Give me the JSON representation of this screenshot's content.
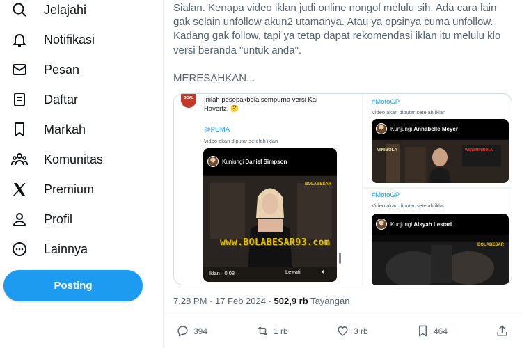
{
  "sidebar": {
    "items": [
      {
        "label": "Jelajahi",
        "icon": "search-icon"
      },
      {
        "label": "Notifikasi",
        "icon": "bell-icon"
      },
      {
        "label": "Pesan",
        "icon": "mail-icon"
      },
      {
        "label": "Daftar",
        "icon": "list-icon"
      },
      {
        "label": "Markah",
        "icon": "bookmark-icon"
      },
      {
        "label": "Komunitas",
        "icon": "people-icon"
      },
      {
        "label": "Premium",
        "icon": "x-logo-icon"
      },
      {
        "label": "Profil",
        "icon": "person-icon"
      },
      {
        "label": "Lainnya",
        "icon": "more-circle-icon"
      }
    ],
    "post_button": "Posting"
  },
  "tweet": {
    "text_line1": "Sialan. Kenapa video iklan judi online nongol melulu sih. Ada cara lain gak selain unfollow akun2 utamanya. Atau ya opsinya cuma unfollow. Kadang gak follow, tapi ya tetap dapat rekomendasi iklan itu melulu klo versi beranda \"untuk anda\".",
    "text_line2": "MERESAHKAN...",
    "time": "7.28 PM · 17 Feb 2024 · ",
    "views_count": "502,9 rb",
    "views_label": " Tayangan"
  },
  "media": {
    "left": {
      "avatar_text": "GOAL",
      "text": "Inilah pesepakbola sempurna versi Kai Havertz. 🤔",
      "mention": "@PUMA",
      "ad_note": "Video akan diputar setelah iklan",
      "visit_prefix": "Kunjungi ",
      "visit_name": "Daniel Simpson",
      "watermark": "www.BOLABESAR93.com",
      "logo": "BOLABESAR",
      "ad_time": "Iklan · 0:08",
      "skip": "Lewati"
    },
    "right_top": {
      "hashtag": "#MotoGP",
      "ad_note": "Video akan diputar setelah iklan",
      "visit_prefix": "Kunjungi ",
      "visit_name": "Annabelle Meyer",
      "sign": "MINIBOLA",
      "banner": "WWW.MINIBOLA"
    },
    "right_bottom": {
      "hashtag": "#MotoGP",
      "ad_note": "Video akan diputar setelah iklan",
      "visit_prefix": "Kunjungi ",
      "visit_name": "Aisyah Lestari",
      "logo": "BOLABESAR"
    }
  },
  "actions": {
    "replies": "394",
    "reposts": "1 rb",
    "likes": "3 rb",
    "bookmarks": "464"
  },
  "colors": {
    "accent": "#1d9bf0",
    "text": "#0f1419",
    "muted": "#536471"
  }
}
